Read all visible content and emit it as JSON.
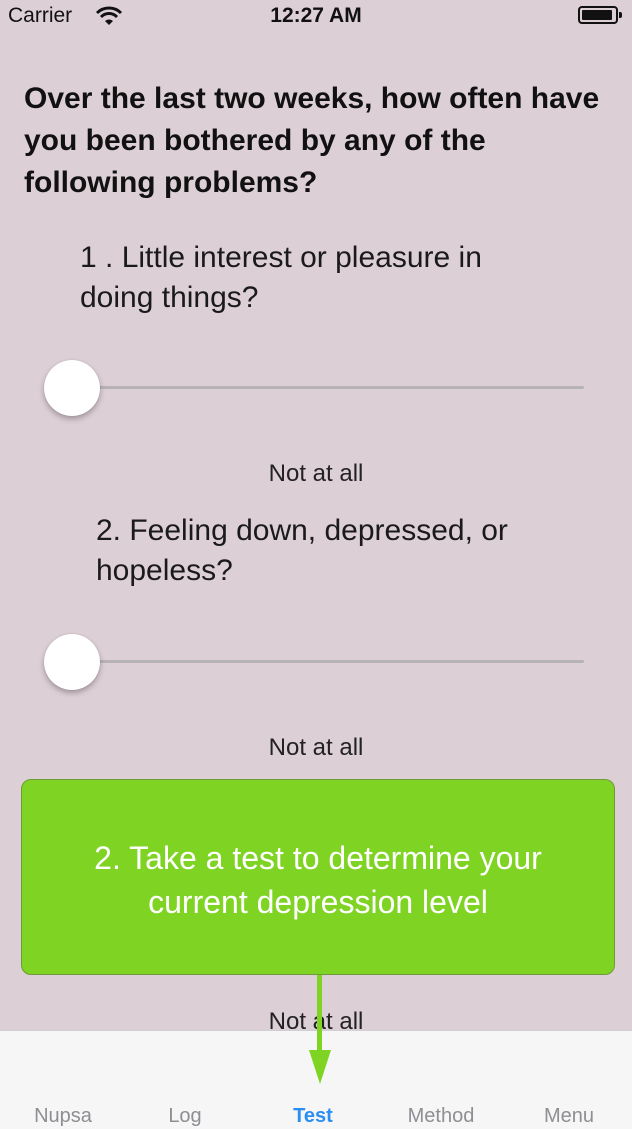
{
  "status_bar": {
    "carrier": "Carrier",
    "time": "12:27 AM",
    "wifi_icon": "wifi-icon",
    "battery_icon": "battery-icon"
  },
  "heading": "Over the last two weeks, how often have you been bothered by any of the following problems?",
  "questions": [
    {
      "text": "1 . Little interest or pleasure in doing things?",
      "answer": "Not at all",
      "slider_value": 0
    },
    {
      "text": "2. Feeling down, depressed, or hopeless?",
      "answer": "Not at all",
      "slider_value": 0
    },
    {
      "answer": "Not at all"
    }
  ],
  "tooltip": {
    "line1": "2. Take a test to determine your",
    "line2": "current depression level",
    "color": "#7fd323"
  },
  "tabs": [
    {
      "label": "Nupsa",
      "active": false
    },
    {
      "label": "Log",
      "active": false
    },
    {
      "label": "Test",
      "active": true
    },
    {
      "label": "Method",
      "active": false
    },
    {
      "label": "Menu",
      "active": false
    }
  ],
  "colors": {
    "background": "#ddcfd6",
    "tab_active": "#2b8ef2",
    "tab_inactive": "#8e8e93"
  }
}
